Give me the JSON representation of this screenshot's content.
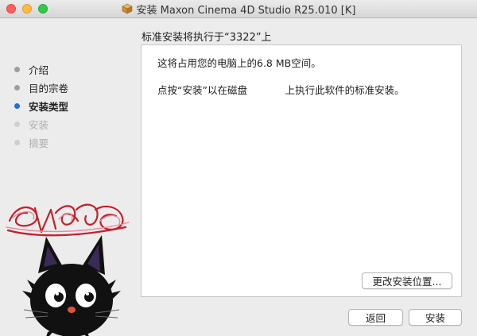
{
  "window": {
    "title": "安装 Maxon Cinema 4D Studio R25.010 [K]"
  },
  "heading": "标准安装将执行于“3322”上",
  "steps": [
    {
      "label": "介绍",
      "state": "done"
    },
    {
      "label": "目的宗卷",
      "state": "done"
    },
    {
      "label": "安装类型",
      "state": "active"
    },
    {
      "label": "安装",
      "state": "disabled"
    },
    {
      "label": "摘要",
      "state": "disabled"
    }
  ],
  "content": {
    "line1": "这将占用您的电脑上的6.8 MB空间。",
    "line2": "点按“安装”以在磁盘            上执行此软件的标准安装。"
  },
  "buttons": {
    "change_location": "更改安装位置...",
    "back": "返回",
    "install": "安装"
  },
  "colors": {
    "active_step": "#1f6fe0",
    "window_bg": "#ececec"
  }
}
